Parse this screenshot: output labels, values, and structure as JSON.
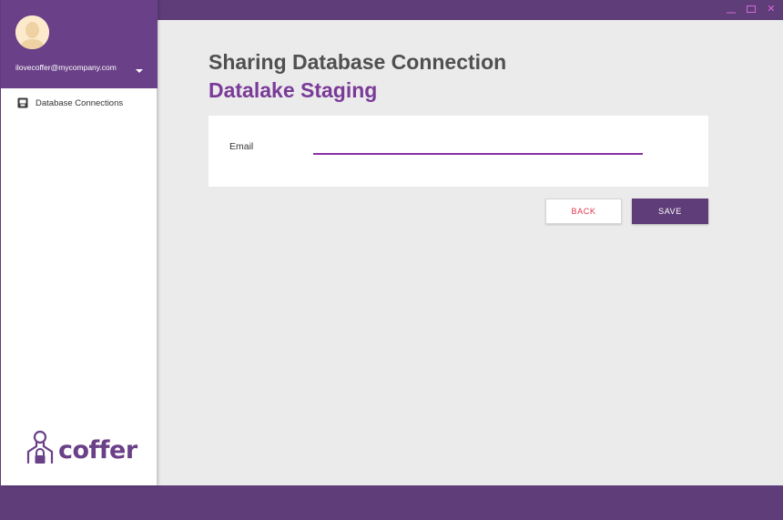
{
  "window": {
    "controls": [
      {
        "name": "minimize",
        "glyph": "minimize-icon"
      },
      {
        "name": "maximize",
        "glyph": "maximize-icon"
      },
      {
        "name": "close",
        "glyph": "✕"
      }
    ]
  },
  "sidebar": {
    "user": {
      "email": "ilovecoffer@mycompany.com"
    },
    "items": [
      {
        "label": "Database Connections",
        "icon": "database-icon"
      }
    ],
    "logo": {
      "text": "coffer"
    }
  },
  "main": {
    "title": "Sharing Database Connection",
    "subtitle": "Datalake Staging",
    "form": {
      "email_label": "Email",
      "email_value": "",
      "email_placeholder": ""
    },
    "buttons": {
      "back_label": "BACK",
      "save_label": "SAVE"
    }
  },
  "colors": {
    "brand": "#5e3d78",
    "accent": "#7a3a98",
    "input_underline": "#8a2fa5",
    "back_text": "#e3344b"
  }
}
